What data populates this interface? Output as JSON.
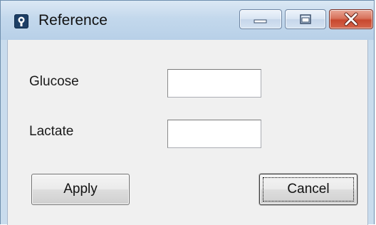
{
  "window": {
    "title": "Reference",
    "icon": "application-icon",
    "caption_buttons": [
      "minimize-icon",
      "maximize-icon",
      "close-icon"
    ]
  },
  "form": {
    "glucose_label": "Glucose",
    "glucose_value": "",
    "lactate_label": "Lactate",
    "lactate_value": ""
  },
  "buttons": {
    "apply_label": "Apply",
    "cancel_label": "Cancel"
  },
  "colors": {
    "titlebar": "#c3d8ec",
    "close_button": "#c8482f",
    "client_background": "#f0f0f0"
  }
}
